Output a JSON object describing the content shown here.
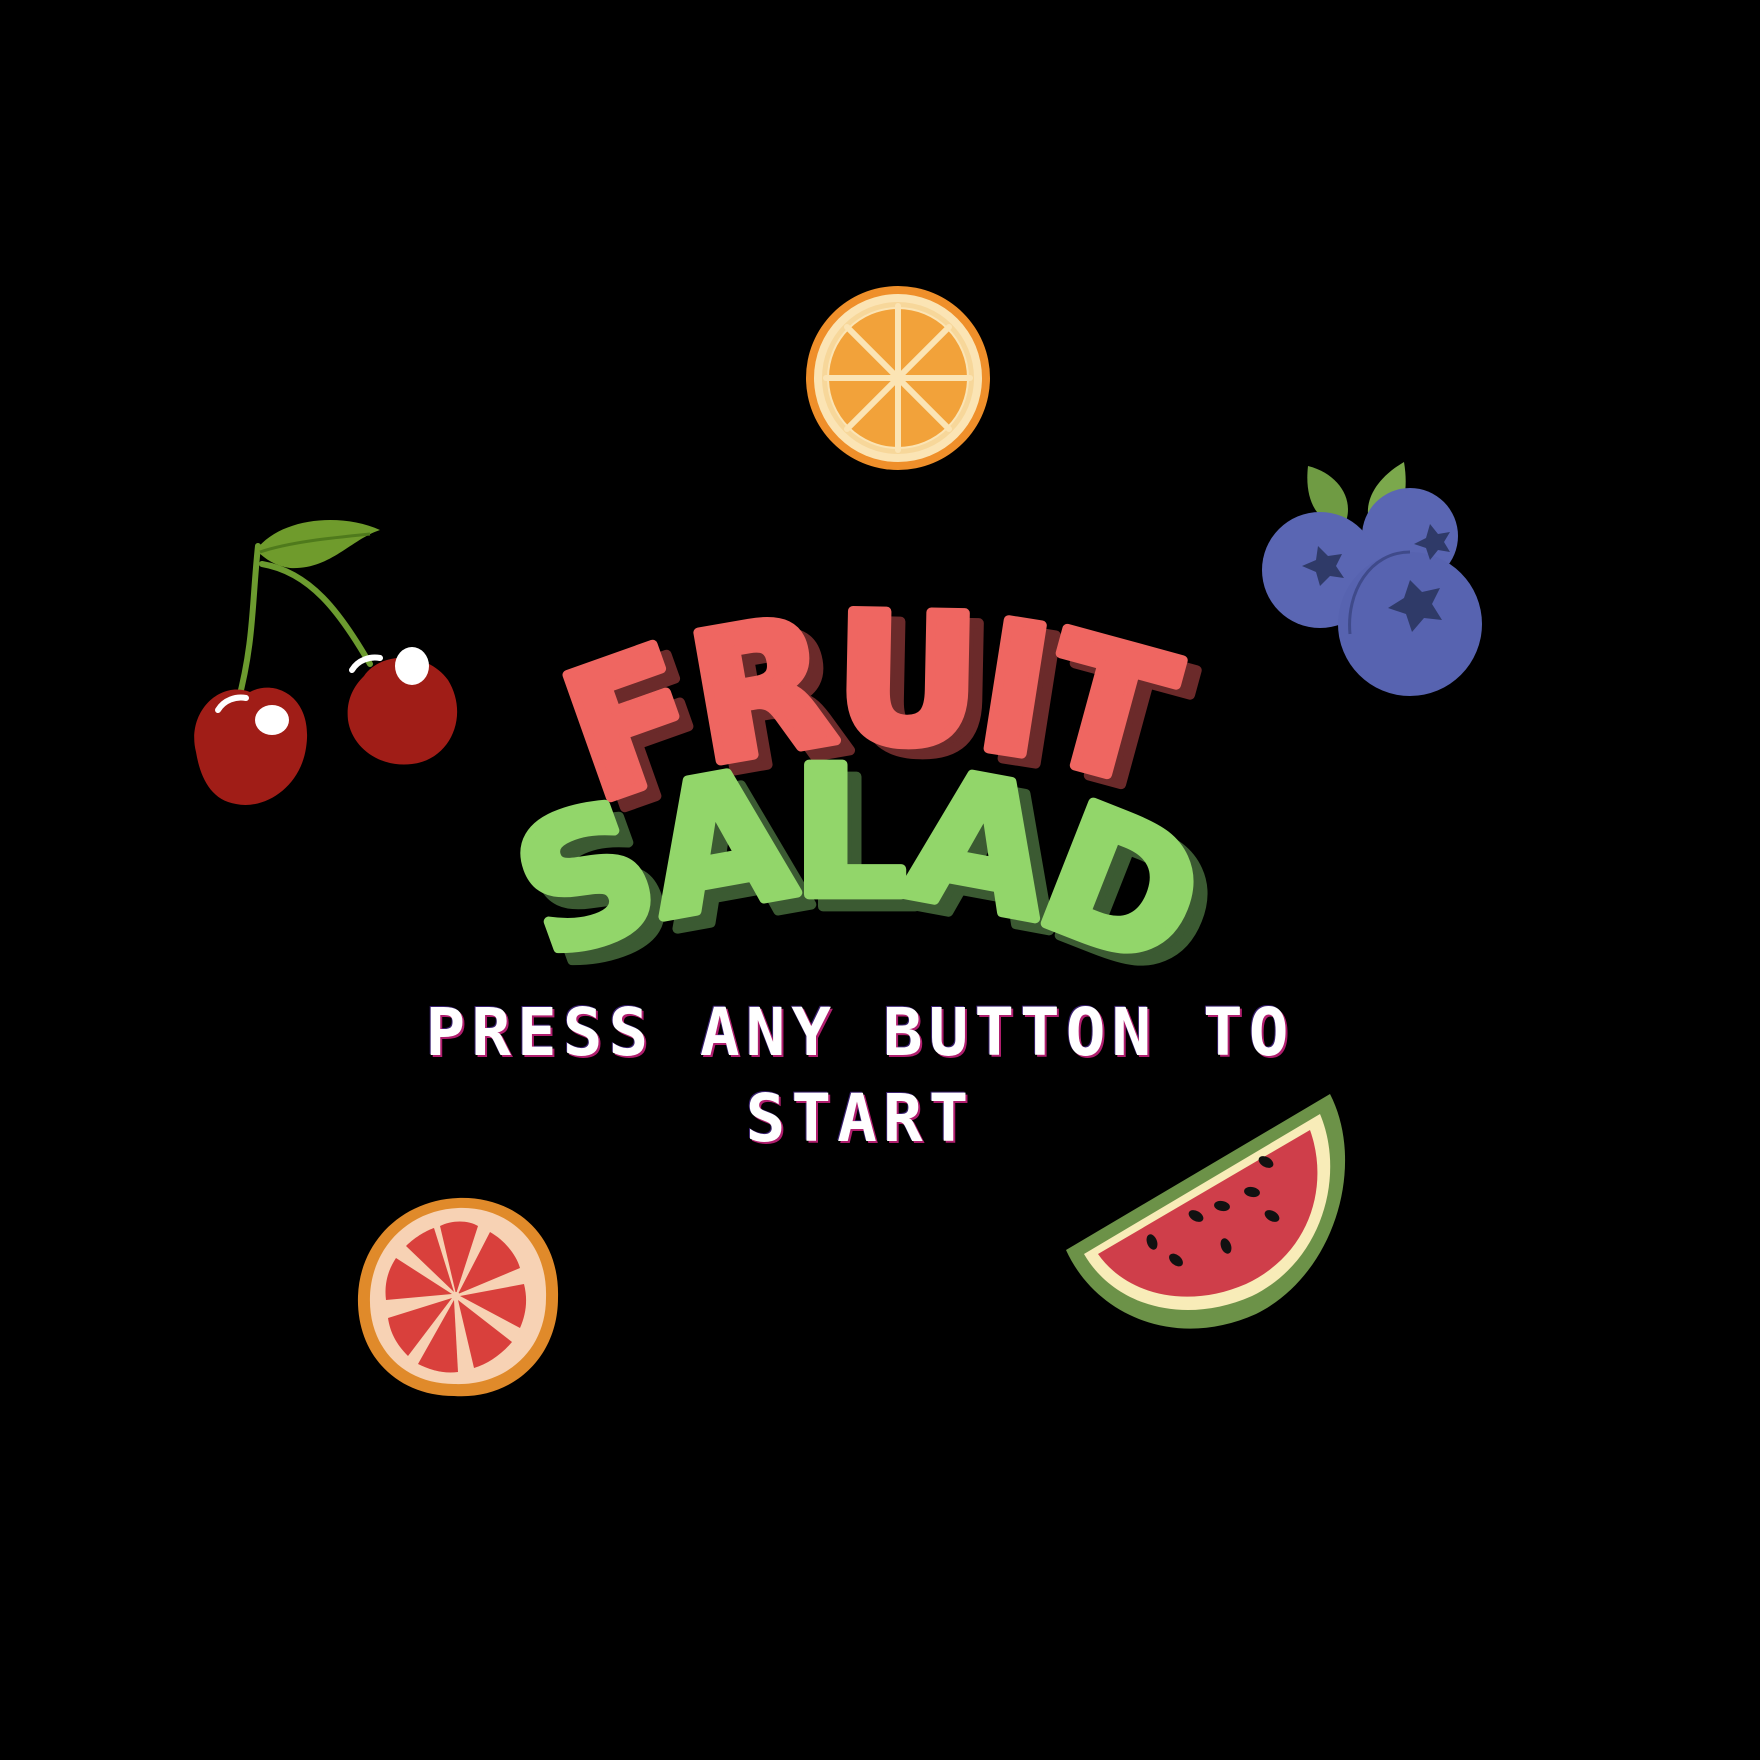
{
  "title": {
    "line1": "FRUIT",
    "line2": "SALAD",
    "line1_color": "#ef6661",
    "line1_shadow": "#6b2a2a",
    "line2_color": "#92d66a",
    "line2_shadow": "#3b5a32"
  },
  "prompt": {
    "line1": "PRESS ANY BUTTON TO",
    "line2": "START",
    "color": "#ffffff"
  },
  "fruits": [
    {
      "name": "orange",
      "icon": "orange-slice-icon",
      "color": "#f2a23a"
    },
    {
      "name": "cherries",
      "icon": "cherries-icon",
      "color": "#a01d17"
    },
    {
      "name": "blueberries",
      "icon": "blueberries-icon",
      "color": "#5a66b3"
    },
    {
      "name": "grapefruit",
      "icon": "grapefruit-slice-icon",
      "color": "#d9403c"
    },
    {
      "name": "watermelon",
      "icon": "watermelon-slice-icon",
      "color": "#cf3e4a"
    }
  ],
  "background": "#000000"
}
